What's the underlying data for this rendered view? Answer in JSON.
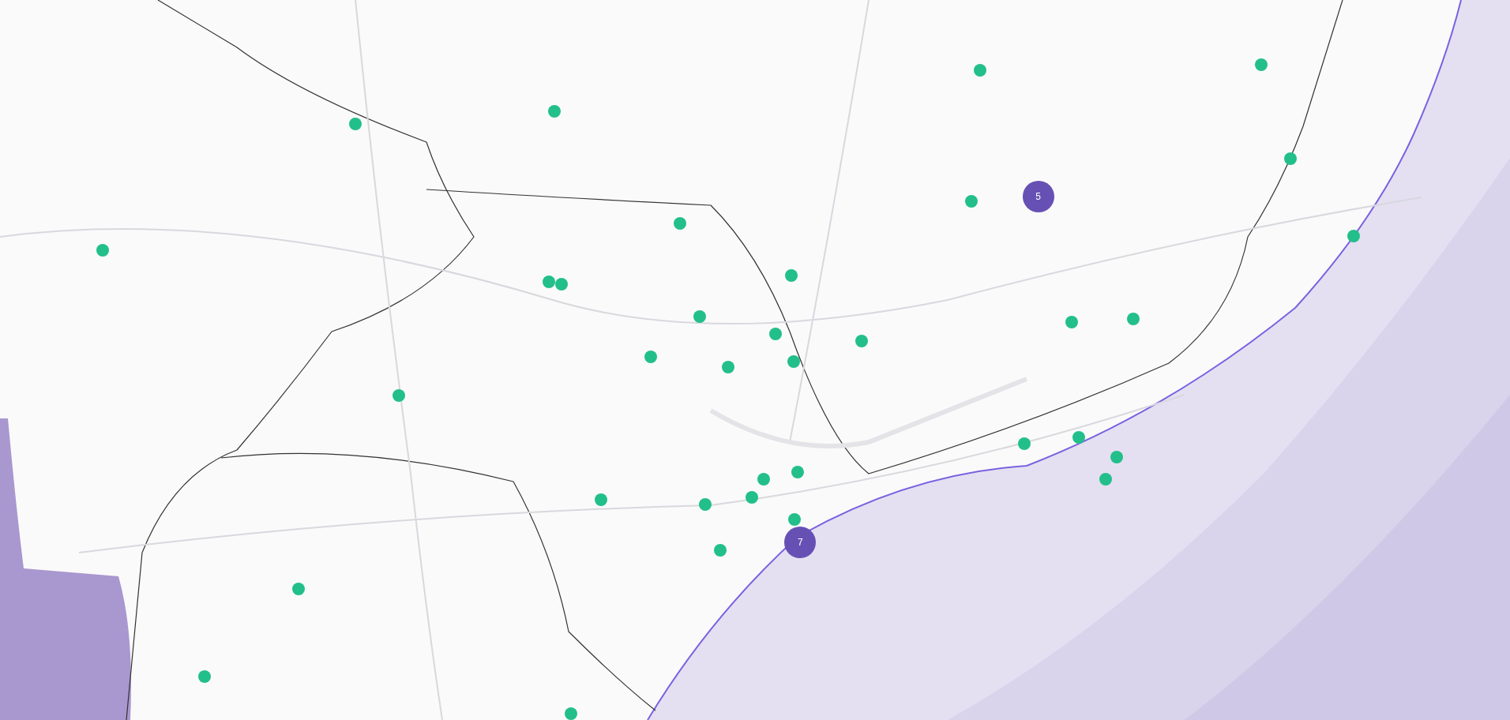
{
  "markers": [
    {
      "kind": "point"
    },
    {
      "kind": "point"
    },
    {
      "kind": "point"
    },
    {
      "kind": "point"
    },
    {
      "kind": "point"
    },
    {
      "kind": "point"
    },
    {
      "kind": "point"
    },
    {
      "kind": "point"
    },
    {
      "kind": "cluster",
      "count": "5"
    },
    {
      "kind": "point"
    },
    {
      "kind": "point"
    },
    {
      "kind": "point"
    },
    {
      "kind": "point"
    },
    {
      "kind": "point"
    },
    {
      "kind": "point"
    },
    {
      "kind": "point"
    },
    {
      "kind": "point"
    },
    {
      "kind": "point"
    },
    {
      "kind": "point"
    },
    {
      "kind": "point"
    },
    {
      "kind": "point"
    },
    {
      "kind": "point"
    },
    {
      "kind": "point"
    },
    {
      "kind": "point"
    },
    {
      "kind": "point"
    },
    {
      "kind": "point"
    },
    {
      "kind": "point"
    },
    {
      "kind": "point"
    },
    {
      "kind": "point"
    },
    {
      "kind": "point"
    },
    {
      "kind": "point"
    },
    {
      "kind": "point"
    },
    {
      "kind": "cluster",
      "count": "7"
    },
    {
      "kind": "point"
    },
    {
      "kind": "point"
    },
    {
      "kind": "point"
    },
    {
      "kind": "point"
    }
  ]
}
